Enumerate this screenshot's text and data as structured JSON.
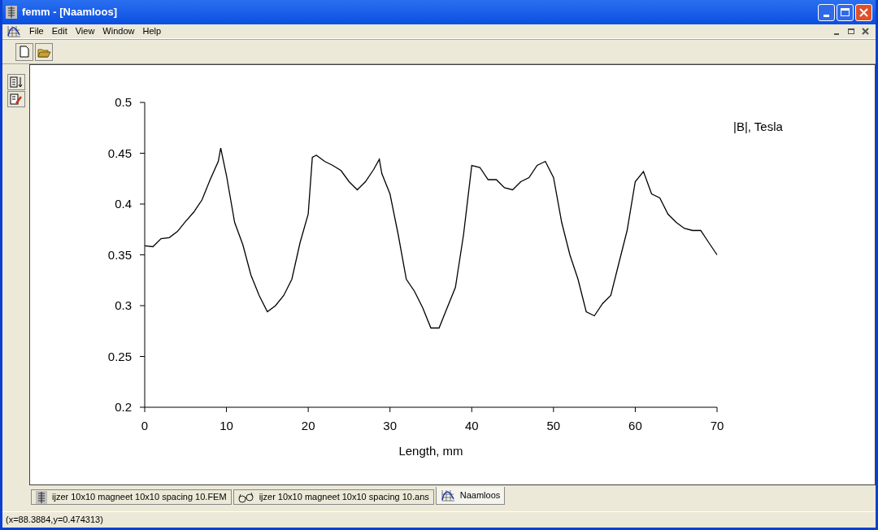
{
  "window": {
    "title": "femm - [Naamloos]"
  },
  "menu": [
    "File",
    "Edit",
    "View",
    "Window",
    "Help"
  ],
  "plot": {
    "chart_data": {
      "type": "line",
      "xlabel": "Length, mm",
      "xlim": [
        0,
        70
      ],
      "ylim": [
        0.2,
        0.5
      ],
      "xticks": [
        0,
        10,
        20,
        30,
        40,
        50,
        60,
        70
      ],
      "yticks": [
        {
          "value": 0.2,
          "label": "0.2"
        },
        {
          "value": 0.25,
          "label": "0.25"
        },
        {
          "value": 0.3,
          "label": "0.3"
        },
        {
          "value": 0.35,
          "label": "0.35"
        },
        {
          "value": 0.4,
          "label": "0.4"
        },
        {
          "value": 0.45,
          "label": "0.45"
        },
        {
          "value": 0.5,
          "label": "0.5"
        }
      ],
      "x": [
        0,
        1,
        2,
        3,
        4,
        5,
        6,
        7,
        8,
        9,
        9.3,
        10,
        11,
        12,
        13,
        14,
        15,
        16,
        17,
        18,
        19,
        20,
        20.5,
        21,
        22,
        23,
        24,
        25,
        26,
        27,
        28,
        28.7,
        29,
        30,
        31,
        32,
        33,
        34,
        35,
        36,
        37,
        38,
        39,
        40,
        41,
        42,
        43,
        44,
        45,
        46,
        47,
        48,
        49,
        50,
        51,
        52,
        53,
        54,
        55,
        56,
        57,
        58,
        59,
        60,
        61,
        62,
        63,
        64,
        65,
        66,
        67,
        68,
        69,
        70
      ],
      "series": [
        {
          "name": "|B|, Tesla",
          "color": "#000000",
          "values": [
            0.359,
            0.358,
            0.366,
            0.367,
            0.373,
            0.383,
            0.392,
            0.404,
            0.424,
            0.442,
            0.455,
            0.428,
            0.382,
            0.36,
            0.33,
            0.31,
            0.294,
            0.3,
            0.31,
            0.326,
            0.362,
            0.39,
            0.446,
            0.448,
            0.442,
            0.438,
            0.433,
            0.422,
            0.414,
            0.422,
            0.434,
            0.444,
            0.43,
            0.41,
            0.37,
            0.326,
            0.314,
            0.298,
            0.278,
            0.278,
            0.298,
            0.318,
            0.37,
            0.438,
            0.436,
            0.424,
            0.424,
            0.416,
            0.414,
            0.422,
            0.426,
            0.438,
            0.442,
            0.426,
            0.382,
            0.35,
            0.326,
            0.294,
            0.29,
            0.302,
            0.31,
            0.342,
            0.374,
            0.422,
            0.432,
            0.41,
            0.406,
            0.39,
            0.382,
            0.376,
            0.374,
            0.374,
            0.362,
            0.35
          ]
        }
      ]
    }
  },
  "document_tabs": [
    {
      "label": "ijzer 10x10 magneet 10x10 spacing 10.FEM",
      "kind": "coil",
      "selected": false
    },
    {
      "label": "ijzer 10x10 magneet 10x10 spacing 10.ans",
      "kind": "glasses",
      "selected": false
    },
    {
      "label": "Naamloos",
      "kind": "plot",
      "selected": true
    }
  ],
  "status_bar": "(x=88.3884,y=0.474313)"
}
